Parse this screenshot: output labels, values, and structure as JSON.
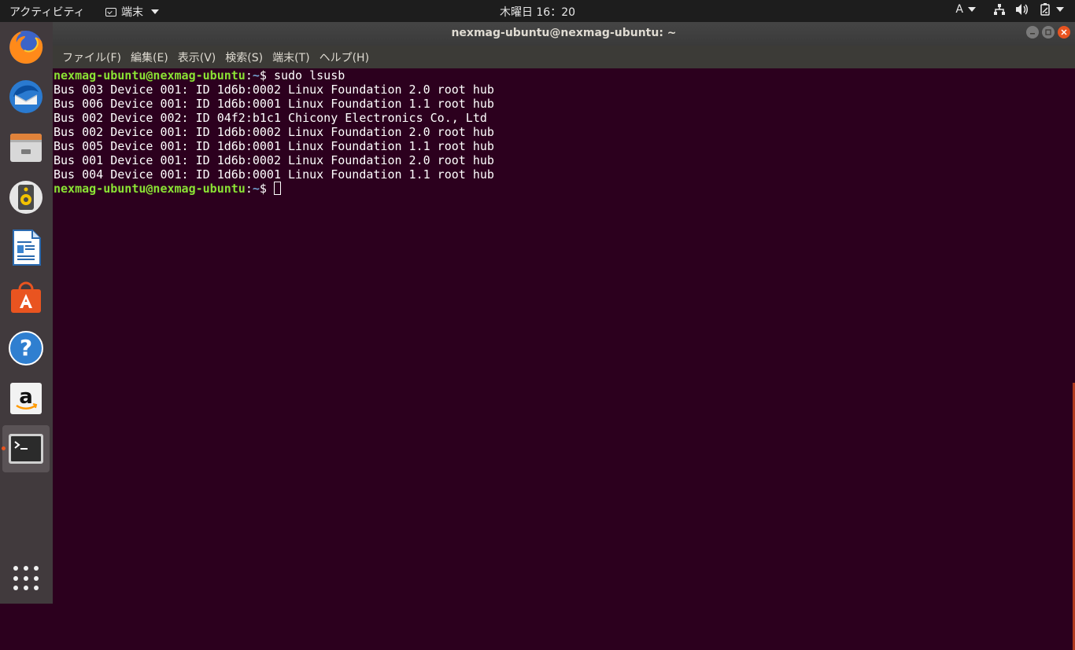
{
  "topbar": {
    "activities": "アクティビティ",
    "app_menu": "端末",
    "clock": "木曜日 16：20",
    "input_method": "A"
  },
  "dock": {
    "items": [
      {
        "name": "firefox-icon"
      },
      {
        "name": "thunderbird-icon"
      },
      {
        "name": "files-icon"
      },
      {
        "name": "rhythmbox-icon"
      },
      {
        "name": "libreoffice-writer-icon"
      },
      {
        "name": "ubuntu-software-icon"
      },
      {
        "name": "help-icon"
      },
      {
        "name": "amazon-icon"
      },
      {
        "name": "terminal-icon"
      }
    ]
  },
  "window": {
    "title": "nexmag-ubuntu@nexmag-ubuntu: ~",
    "menu": [
      "ファイル(F)",
      "編集(E)",
      "表示(V)",
      "検索(S)",
      "端末(T)",
      "ヘルプ(H)"
    ]
  },
  "terminal": {
    "prompt_user": "nexmag-ubuntu@nexmag-ubuntu",
    "prompt_sep": ":",
    "prompt_path": "~",
    "prompt_dollar": "$ ",
    "command": "sudo lsusb",
    "output": [
      "Bus 003 Device 001: ID 1d6b:0002 Linux Foundation 2.0 root hub",
      "Bus 006 Device 001: ID 1d6b:0001 Linux Foundation 1.1 root hub",
      "Bus 002 Device 002: ID 04f2:b1c1 Chicony Electronics Co., Ltd",
      "Bus 002 Device 001: ID 1d6b:0002 Linux Foundation 2.0 root hub",
      "Bus 005 Device 001: ID 1d6b:0001 Linux Foundation 1.1 root hub",
      "Bus 001 Device 001: ID 1d6b:0002 Linux Foundation 2.0 root hub",
      "Bus 004 Device 001: ID 1d6b:0001 Linux Foundation 1.1 root hub"
    ]
  },
  "colors": {
    "terminal_bg": "#2c001e",
    "prompt_user": "#8ae234",
    "prompt_path": "#729fcf",
    "accent": "#e95420"
  }
}
